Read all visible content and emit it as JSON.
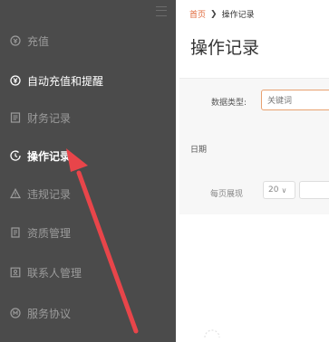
{
  "sidebar": {
    "items": [
      {
        "label": "充值",
        "icon": "coin-circle-icon"
      },
      {
        "label": "自动充值和提醒",
        "icon": "auto-recharge-icon"
      },
      {
        "label": "财务记录",
        "icon": "finance-record-icon"
      },
      {
        "label": "操作记录",
        "icon": "clock-icon",
        "active": true
      },
      {
        "label": "违规记录",
        "icon": "warning-triangle-icon"
      },
      {
        "label": "资质管理",
        "icon": "document-icon"
      },
      {
        "label": "联系人管理",
        "icon": "contact-card-icon"
      },
      {
        "label": "服务协议",
        "icon": "agreement-icon"
      }
    ]
  },
  "breadcrumb": {
    "home": "首页",
    "separator": "❯",
    "current": "操作记录"
  },
  "page": {
    "title": "操作记录"
  },
  "filter": {
    "label": "数据类型:",
    "placeholder": "关键词"
  },
  "table": {
    "date_header": "日期"
  },
  "pager": {
    "label": "每页展现",
    "page_size": "20",
    "more": ""
  },
  "colors": {
    "sidebar_bg": "#4b4b4b",
    "accent": "#e0683a",
    "annotation_arrow": "#e8454a"
  }
}
